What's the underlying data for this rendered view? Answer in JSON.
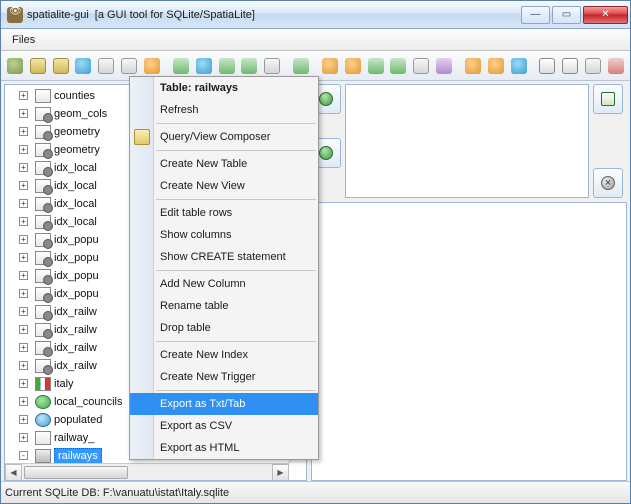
{
  "window": {
    "app_title": "spatialite-gui",
    "subtitle": "[a GUI tool for SQLite/SpatiaLite]"
  },
  "menubar": {
    "files": "Files"
  },
  "toolbar_icons": [
    "brush-icon",
    "db-open-icon",
    "db-mem-icon",
    "db-new-icon",
    "db-save-icon",
    "db-close-icon",
    "db-vacuum-icon",
    "sql-icon",
    "compose-icon",
    "shp-export-icon",
    "shp-import-icon",
    "dxf-icon",
    "run-icon",
    "layers-icon",
    "style-icon",
    "import-icon",
    "export-icon",
    "raster-icon",
    "network-icon",
    "overlay1-icon",
    "overlay2-icon",
    "globe-icon",
    "text-select-icon",
    "text-icon",
    "settings-icon",
    "help-icon"
  ],
  "tree_items": [
    {
      "label": "counties",
      "icon": "table",
      "exp": "+"
    },
    {
      "label": "geom_cols",
      "icon": "table-gear",
      "exp": "+"
    },
    {
      "label": "geometry",
      "icon": "table-gear",
      "exp": "+"
    },
    {
      "label": "geometry",
      "icon": "table-gear",
      "exp": "+"
    },
    {
      "label": "idx_local",
      "icon": "table-gear",
      "exp": "+"
    },
    {
      "label": "idx_local",
      "icon": "table-gear",
      "exp": "+"
    },
    {
      "label": "idx_local",
      "icon": "table-gear",
      "exp": "+"
    },
    {
      "label": "idx_local",
      "icon": "table-gear",
      "exp": "+"
    },
    {
      "label": "idx_popu",
      "icon": "table-gear",
      "exp": "+"
    },
    {
      "label": "idx_popu",
      "icon": "table-gear",
      "exp": "+"
    },
    {
      "label": "idx_popu",
      "icon": "table-gear",
      "exp": "+"
    },
    {
      "label": "idx_popu",
      "icon": "table-gear",
      "exp": "+"
    },
    {
      "label": "idx_railw",
      "icon": "table-gear",
      "exp": "+"
    },
    {
      "label": "idx_railw",
      "icon": "table-gear",
      "exp": "+"
    },
    {
      "label": "idx_railw",
      "icon": "table-gear",
      "exp": "+"
    },
    {
      "label": "idx_railw",
      "icon": "table-gear",
      "exp": "+"
    },
    {
      "label": "italy",
      "icon": "flag",
      "exp": "+"
    },
    {
      "label": "local_councils",
      "icon": "globe",
      "exp": "+"
    },
    {
      "label": "populated",
      "icon": "globe2",
      "exp": "+"
    },
    {
      "label": "railway_",
      "icon": "table",
      "exp": "+"
    },
    {
      "label": "railways",
      "icon": "rail",
      "exp": "-",
      "selected": true
    }
  ],
  "context_menu": {
    "header": "Table: railways",
    "items": [
      {
        "label": "Refresh"
      },
      "sep",
      {
        "label": "Query/View Composer",
        "icon": true
      },
      "sep",
      {
        "label": "Create New Table"
      },
      {
        "label": "Create New View"
      },
      "sep",
      {
        "label": "Edit table rows"
      },
      {
        "label": "Show columns"
      },
      {
        "label": "Show CREATE statement"
      },
      "sep",
      {
        "label": "Add New Column"
      },
      {
        "label": "Rename table"
      },
      {
        "label": "Drop table"
      },
      "sep",
      {
        "label": "Create New Index"
      },
      {
        "label": "Create New Trigger"
      },
      "sep",
      {
        "label": "Export as Txt/Tab",
        "highlight": true
      },
      {
        "label": "Export as CSV"
      },
      {
        "label": "Export as HTML"
      }
    ]
  },
  "statusbar": {
    "text": "Current SQLite DB: F:\\vanuatu\\istat\\Italy.sqlite"
  }
}
